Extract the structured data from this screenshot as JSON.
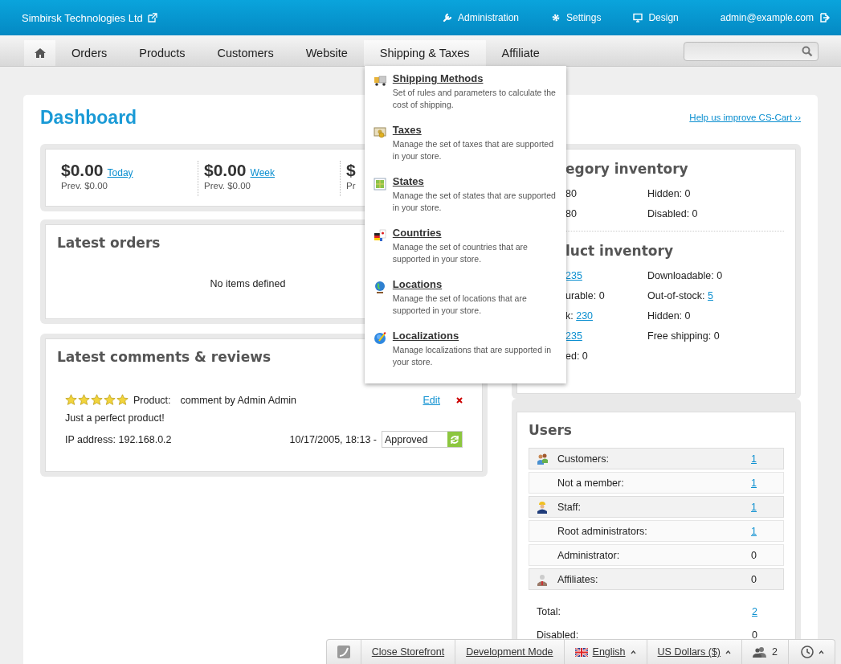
{
  "top_bar": {
    "company": "Simbirsk Technologies Ltd",
    "links": [
      {
        "label": "Administration"
      },
      {
        "label": "Settings"
      },
      {
        "label": "Design"
      }
    ],
    "user": "admin@example.com"
  },
  "nav": {
    "items": [
      {
        "kind": "home",
        "selected": true
      },
      {
        "kind": "text",
        "label": "Orders",
        "selected": false
      },
      {
        "kind": "text",
        "label": "Products",
        "selected": false
      },
      {
        "kind": "text",
        "label": "Customers",
        "selected": false
      },
      {
        "kind": "text",
        "label": "Website",
        "selected": false
      },
      {
        "kind": "text",
        "label": "Shipping & Taxes",
        "selected": true,
        "menu": [
          {
            "title": "Shipping Methods",
            "description": "Set of rules and parameters to calculate the cost of shipping."
          },
          {
            "title": "Taxes",
            "description": "Manage the set of taxes that are supported in your store."
          },
          {
            "title": "States",
            "description": "Manage the set of states that are supported in your store."
          },
          {
            "title": "Countries",
            "description": "Manage the set of countries that are supported in your store."
          },
          {
            "title": "Locations",
            "description": "Manage the set of locations that are supported in your store."
          },
          {
            "title": "Localizations",
            "description": "Manage localizations that are supported in your store."
          }
        ]
      },
      {
        "kind": "text",
        "label": "Affiliate",
        "selected": false
      }
    ]
  },
  "page": {
    "title": "Dashboard",
    "help_link": "Help us improve CS-Cart ››"
  },
  "stats": [
    {
      "amount": "$0.00",
      "period": "Today",
      "previous": "Prev. $0.00"
    },
    {
      "amount": "$0.00",
      "period": "Week",
      "previous": "Prev. $0.00"
    },
    {
      "amount": "$",
      "previous": "Pr"
    }
  ],
  "latest_orders": {
    "title": "Latest orders",
    "empty_text": "No items defined"
  },
  "reviews": {
    "title": "Latest comments & reviews",
    "items": [
      {
        "stars": 5,
        "product_label": "Product:",
        "author": "comment by Admin Admin",
        "edit": "Edit",
        "text": "Just a perfect product!",
        "ip": "IP address: 192.168.0.2",
        "date": "10/17/2005, 18:13 -",
        "status": "Approved"
      }
    ]
  },
  "category_inventory": {
    "title": "egory inventory",
    "rows": [
      [
        {
          "text": "80"
        },
        {
          "text": "Hidden: 0"
        }
      ],
      [
        {
          "text": "80"
        },
        {
          "text": "Disabled: 0"
        }
      ]
    ]
  },
  "product_inventory": {
    "title": "luct inventory",
    "rows": [
      [
        {
          "link": "235"
        },
        {
          "text": "Downloadable: 0"
        }
      ],
      [
        {
          "text": "urable: 0"
        },
        {
          "text": "Out-of-stock: ",
          "link": "5"
        }
      ],
      [
        {
          "text": "k: ",
          "link": "230"
        },
        {
          "text": "Hidden: 0"
        }
      ],
      [
        {
          "link": "235"
        },
        {
          "text": "Free shipping: 0"
        }
      ],
      [
        {
          "text": "ed: 0"
        }
      ]
    ]
  },
  "users": {
    "title": "Users",
    "rows": [
      {
        "kind": "group",
        "label": "Customers:",
        "value": "1",
        "linked": true
      },
      {
        "kind": "sub",
        "label": "Not a member:",
        "value": "1",
        "linked": true
      },
      {
        "kind": "group",
        "label": "Staff:",
        "value": "1",
        "linked": true
      },
      {
        "kind": "sub",
        "label": "Root administrators:",
        "value": "1",
        "linked": true
      },
      {
        "kind": "sub",
        "label": "Administrator:",
        "value": "0",
        "linked": false
      },
      {
        "kind": "group",
        "label": "Affiliates:",
        "value": "0",
        "linked": false
      }
    ],
    "totals": [
      {
        "label": "Total:",
        "value": "2",
        "linked": true
      },
      {
        "label": "Disabled:",
        "value": "0",
        "linked": false
      }
    ]
  },
  "bottom_bar": {
    "close_storefront": "Close Storefront",
    "mode": "Development Mode",
    "language": "English",
    "currency": "US Dollars ($)",
    "users_online": "2"
  }
}
